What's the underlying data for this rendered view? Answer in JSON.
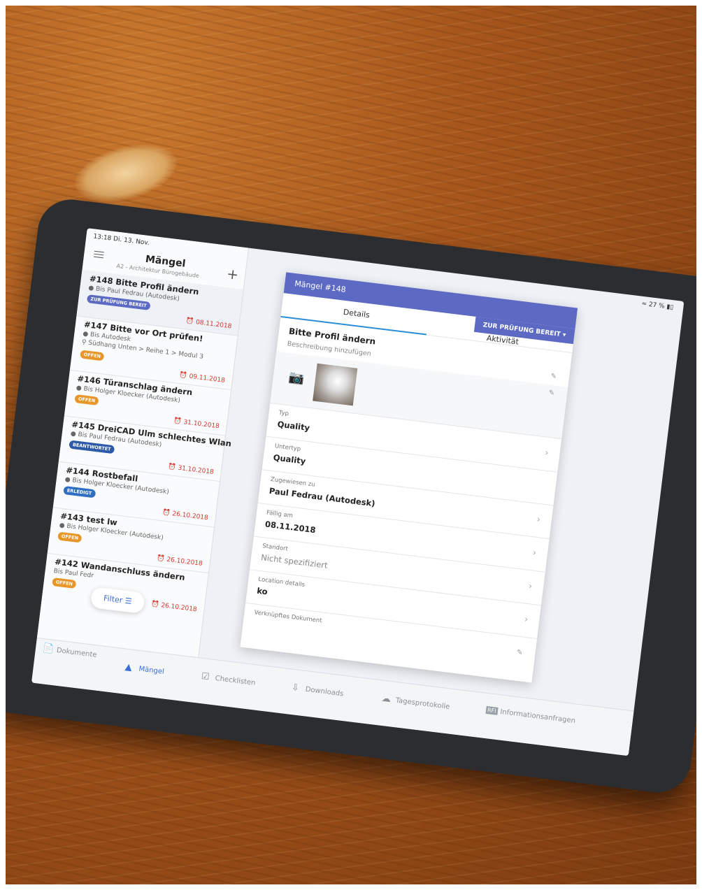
{
  "status": {
    "time": "13:18",
    "date": "Di. 13. Nov.",
    "battery": "27 %"
  },
  "list": {
    "title": "Mängel",
    "subtitle": "A2 - Architektur Bürogebäude",
    "filter_label": "Filter",
    "items": [
      {
        "title": "#148 Bitte Profil ändern",
        "assignee": "Bis Paul Fedrau (Autodesk)",
        "status": "ZUR PRÜFUNG BEREIT",
        "status_color": "#5c6ac4",
        "due": "08.11.2018",
        "location": ""
      },
      {
        "title": "#147 Bitte vor Ort prüfen!",
        "assignee": "Bis Autodesk",
        "status": "OFFEN",
        "status_color": "#e8962a",
        "due": "09.11.2018",
        "location": "Südhang Unten > Reihe 1 > Modul 3"
      },
      {
        "title": "#146 Türanschlag ändern",
        "assignee": "Bis Holger Kloecker (Autodesk)",
        "status": "OFFEN",
        "status_color": "#e8962a",
        "due": "31.10.2018",
        "location": ""
      },
      {
        "title": "#145 DreiCAD Ulm schlechtes Wlan",
        "assignee": "Bis Paul Fedrau (Autodesk)",
        "status": "BEANTWORTET",
        "status_color": "#2c5aa8",
        "due": "31.10.2018",
        "location": ""
      },
      {
        "title": "#144 Rostbefall",
        "assignee": "Bis Holger Kloecker (Autodesk)",
        "status": "ERLEDIGT",
        "status_color": "#2f6fc2",
        "due": "26.10.2018",
        "location": ""
      },
      {
        "title": "#143 test lw",
        "assignee": "Bis Holger Kloecker (Autodesk)",
        "status": "OFFEN",
        "status_color": "#e8962a",
        "due": "26.10.2018",
        "location": ""
      },
      {
        "title": "#142 Wandanschluss ändern",
        "assignee": "Bis Paul Fedr",
        "status": "OFFEN",
        "status_color": "#e8962a",
        "due": "26.10.2018",
        "location": ""
      }
    ]
  },
  "detail": {
    "header_prefix": "Mängel",
    "header_number": "#148",
    "tab_details": "Details",
    "tab_activity": "Aktivität",
    "status_button": "ZUR PRÜFUNG BEREIT",
    "title": "Bitte Profil ändern",
    "description_placeholder": "Beschreibung hinzufügen",
    "fields": [
      {
        "label": "Typ",
        "value": "Quality"
      },
      {
        "label": "Untertyp",
        "value": "Quality"
      },
      {
        "label": "Zugewiesen zu",
        "value": "Paul Fedrau (Autodesk)"
      },
      {
        "label": "Fällig am",
        "value": "08.11.2018"
      },
      {
        "label": "Standort",
        "value": "Nicht spezifiziert"
      },
      {
        "label": "Location details",
        "value": "ko"
      },
      {
        "label": "Verknüpftes Dokument",
        "value": ""
      }
    ]
  },
  "tabbar": [
    {
      "label": "Dokumente",
      "icon": "document-icon"
    },
    {
      "label": "Mängel",
      "icon": "warning-icon"
    },
    {
      "label": "Checklisten",
      "icon": "checkbox-icon"
    },
    {
      "label": "Downloads",
      "icon": "download-icon"
    },
    {
      "label": "Tagesprotokolle",
      "icon": "weather-icon"
    },
    {
      "label": "Informationsanfragen",
      "icon": "rfi-icon"
    }
  ],
  "colors": {
    "accent": "#5c6ac4",
    "link": "#3b6fd4",
    "due": "#d9342b"
  }
}
